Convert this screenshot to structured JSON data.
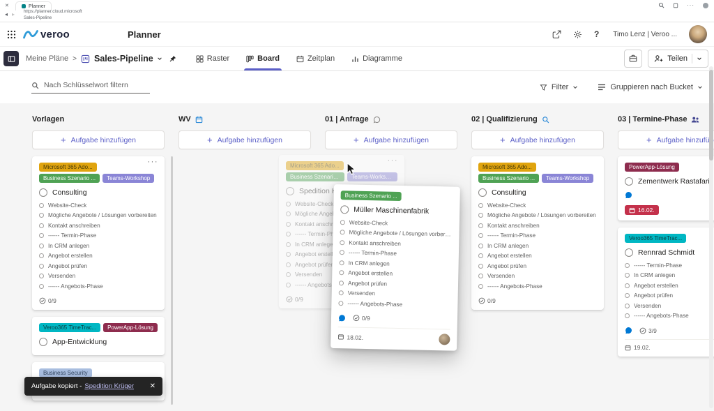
{
  "browser": {
    "close_icon": "✕",
    "tab_title": "Planner",
    "url_line1": "https://planner.cloud.microsoft",
    "url_line2": "Sales-Pipeline"
  },
  "header": {
    "logo_text": "veroo",
    "app_title": "Planner",
    "user_label": "Timo Lenz | Veroo ..."
  },
  "toolbar": {
    "breadcrumb": "Meine Pläne",
    "breadcrumb_separator": ">",
    "plan_title": "Sales-Pipeline",
    "tabs": [
      {
        "label": "Raster",
        "icon": "grid-icon",
        "active": false
      },
      {
        "label": "Board",
        "icon": "board-icon",
        "active": true
      },
      {
        "label": "Zeitplan",
        "icon": "timeline-icon",
        "active": false
      },
      {
        "label": "Diagramme",
        "icon": "chart-icon",
        "active": false
      }
    ],
    "share_label": "Teilen"
  },
  "filter_bar": {
    "search_placeholder": "Nach Schlüsselwort filtern",
    "filter_label": "Filter",
    "group_label": "Gruppieren nach Bucket"
  },
  "board": {
    "add_task_label": "Aufgabe hinzufügen",
    "columns": [
      {
        "name": "Vorlagen",
        "icon": null,
        "cards": [
          {
            "menu": true,
            "labels": [
              [
                {
                  "text": "Microsoft 365 Ado...",
                  "color": "gold"
                }
              ],
              [
                {
                  "text": "Business Szenario ...",
                  "color": "green"
                },
                {
                  "text": "Teams-Workshop",
                  "color": "purple"
                }
              ]
            ],
            "title": "Consulting",
            "checklist": [
              "Website-Check",
              "Mögliche Angebote / Lösungen vorbereiten",
              "Kontakt anschreiben",
              "------ Termin-Phase",
              "In CRM anlegen",
              "Angebot erstellen",
              "Angebot prüfen",
              "Versenden",
              "------ Angebots-Phase"
            ],
            "progress": "0/9"
          },
          {
            "labels": [
              [
                {
                  "text": "Veroo365 TimeTrac...",
                  "color": "teal"
                },
                {
                  "text": "PowerApp-Lösung",
                  "color": "berry"
                }
              ]
            ],
            "title": "App-Entwicklung"
          },
          {
            "labels": [
              [
                {
                  "text": "Business Security",
                  "color": "steel"
                }
              ]
            ],
            "title": ""
          }
        ]
      },
      {
        "name": "WV",
        "icon": "calendar-icon",
        "cards": []
      },
      {
        "name": "01 | Anfrage",
        "icon": "comment-icon",
        "cards": []
      },
      {
        "name": "02 | Qualifizierung",
        "icon": "search-small-icon",
        "cards": [
          {
            "labels": [
              [
                {
                  "text": "Microsoft 365 Ado...",
                  "color": "gold"
                }
              ],
              [
                {
                  "text": "Business Szenario ...",
                  "color": "green"
                },
                {
                  "text": "Teams-Workshop",
                  "color": "purple"
                }
              ]
            ],
            "title": "Consulting",
            "checklist": [
              "Website-Check",
              "Mögliche Angebote / Lösungen vorbereiten",
              "Kontakt anschreiben",
              "------ Termin-Phase",
              "In CRM anlegen",
              "Angebot erstellen",
              "Angebot prüfen",
              "Versenden",
              "------ Angebots-Phase"
            ],
            "progress": "0/9"
          }
        ]
      },
      {
        "name": "03 | Termine-Phase",
        "icon": "people-icon",
        "cards": [
          {
            "labels": [
              [
                {
                  "text": "PowerApp-Lösung",
                  "color": "berry"
                }
              ]
            ],
            "title": "Zementwerk Rastafari",
            "comment": true,
            "due": {
              "text": "16.02.",
              "overdue": true
            }
          },
          {
            "labels": [
              [
                {
                  "text": "Veroo365 TimeTrac...",
                  "color": "teal"
                }
              ]
            ],
            "title": "Rennrad Schmidt",
            "checklist": [
              "------ Termin-Phase",
              "In CRM anlegen",
              "Angebot erstellen",
              "Angebot prüfen",
              "Versenden",
              "------ Angebots-Phase"
            ],
            "comment": true,
            "progress": "3/9",
            "due": {
              "text": "19.02.",
              "overdue": false
            }
          }
        ]
      }
    ],
    "ghost_card": {
      "menu": true,
      "labels": [
        [
          {
            "text": "Microsoft 365 Ado...",
            "color": "gold"
          }
        ],
        [
          {
            "text": "Business Szenario ...",
            "color": "green"
          },
          {
            "text": "Teams-Workshop",
            "color": "purple"
          }
        ]
      ],
      "title": "Spedition Krüger",
      "checklist": [
        "Website-Check",
        "Mögliche Angebote / Lösungen vorbereiten",
        "Kontakt anschreiben",
        "------ Termin-Phase",
        "In CRM anlegen",
        "Angebot erstellen",
        "Angebot prüfen",
        "Versenden",
        "------ Angebots-Phase"
      ],
      "progress": "0/9"
    },
    "drag_card": {
      "labels": [
        [
          {
            "text": "Business Szenario ...",
            "color": "green"
          }
        ]
      ],
      "title": "Müller Maschinenfabrik",
      "checklist": [
        "Website-Check",
        "Mögliche Angebote / Lösungen vorbereiten",
        "Kontakt anschreiben",
        "------ Termin-Phase",
        "In CRM anlegen",
        "Angebot erstellen",
        "Angebot prüfen",
        "Versenden",
        "------ Angebots-Phase"
      ],
      "comment": true,
      "progress": "0/9",
      "due": {
        "text": "18.02.",
        "overdue": false
      },
      "avatar": true
    }
  },
  "toast": {
    "message": "Aufgabe kopiert -",
    "link": "Spedition Krüger",
    "close": "✕"
  },
  "colors": {
    "accent": "#5b5fc7",
    "overdue": "#c4314b",
    "comment_blue": "#0078d4",
    "labels": {
      "gold": {
        "bg": "#e0a40e",
        "fg": "#463a08"
      },
      "green": {
        "bg": "#4fa254",
        "fg": "#ffffff"
      },
      "purple": {
        "bg": "#8a85d6",
        "fg": "#ffffff"
      },
      "teal": {
        "bg": "#00b7c3",
        "fg": "#093c40"
      },
      "berry": {
        "bg": "#8e2c4e",
        "fg": "#ffffff"
      },
      "steel": {
        "bg": "#a8bddf",
        "fg": "#30435c"
      }
    }
  }
}
